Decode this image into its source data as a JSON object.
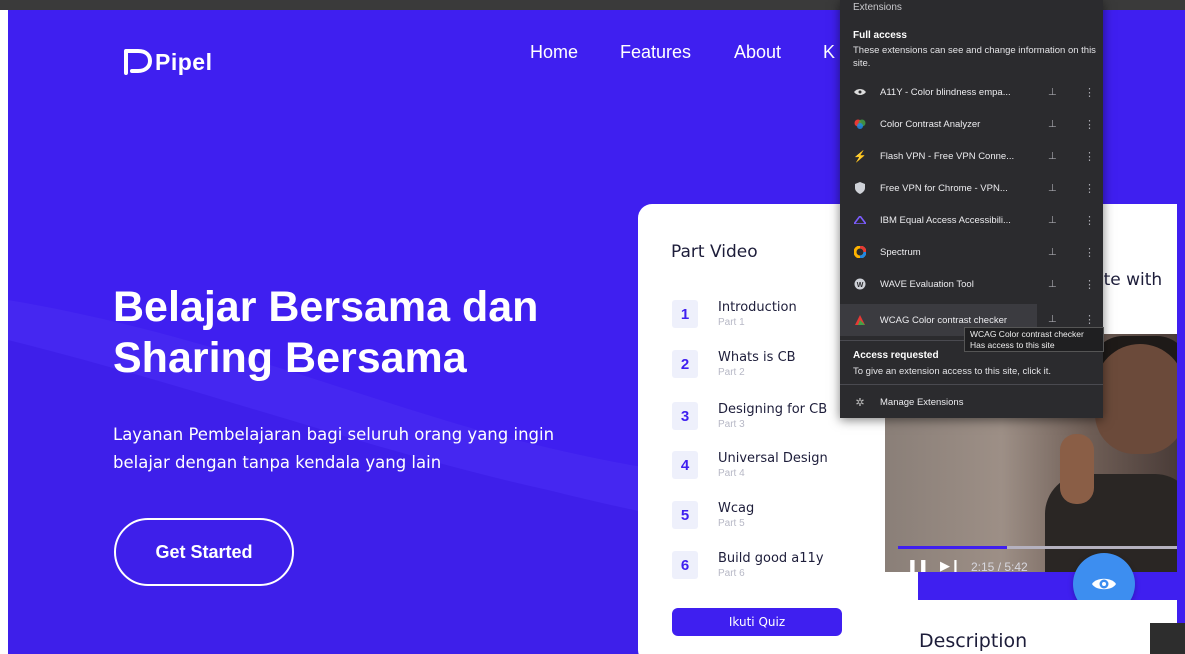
{
  "brand": {
    "name": "Pipel"
  },
  "nav": {
    "items": [
      "Home",
      "Features",
      "About",
      "K"
    ]
  },
  "hero": {
    "title": "Belajar Bersama dan Sharing Bersama",
    "subtitle": "Layanan Pembelajaran bagi seluruh orang yang ingin belajar dengan tanpa kendala yang lain",
    "cta_label": "Get Started"
  },
  "part_video": {
    "title": "Part Video",
    "parts": [
      {
        "num": "1",
        "name": "Introduction",
        "sub": "Part 1"
      },
      {
        "num": "2",
        "name": "Whats is CB",
        "sub": "Part 2"
      },
      {
        "num": "3",
        "name": "Designing for CB",
        "sub": "Part 3"
      },
      {
        "num": "4",
        "name": "Universal Design",
        "sub": "Part 4"
      },
      {
        "num": "5",
        "name": "Wcag",
        "sub": "Part 5"
      },
      {
        "num": "6",
        "name": "Build good a11y",
        "sub": "Part 6"
      }
    ],
    "quiz_label": "Ikuti Quiz"
  },
  "right_card": {
    "partial_title": "site with"
  },
  "video": {
    "time": "2:15 / 5:42",
    "progress": 0.39
  },
  "description": {
    "title": "Description"
  },
  "extensions_popup": {
    "header": "Extensions",
    "full_access_title": "Full access",
    "full_access_desc": "These extensions can see and change information on this site.",
    "items": [
      {
        "name": "A11Y - Color blindness empa...",
        "icon": "a11y-eye-icon"
      },
      {
        "name": "Color Contrast Analyzer",
        "icon": "color-contrast-icon"
      },
      {
        "name": "Flash VPN - Free VPN Conne...",
        "icon": "lightning-icon"
      },
      {
        "name": "Free VPN for Chrome - VPN...",
        "icon": "shield-icon"
      },
      {
        "name": "IBM Equal Access Accessibili...",
        "icon": "ibm-icon"
      },
      {
        "name": "Spectrum",
        "icon": "spectrum-icon"
      },
      {
        "name": "WAVE Evaluation Tool",
        "icon": "wave-icon"
      },
      {
        "name": "WCAG Color contrast checker",
        "icon": "wcag-icon"
      }
    ],
    "tooltip_line1": "WCAG Color contrast checker",
    "tooltip_line2": "Has access to this site",
    "access_requested_title": "Access requested",
    "access_requested_desc": "To give an extension access to this site, click it.",
    "manage_label": "Manage Extensions"
  },
  "colors": {
    "brand_blue": "#3f1ff0",
    "popup_bg": "#2b2b2e",
    "eye_button": "#3d8ef0"
  }
}
